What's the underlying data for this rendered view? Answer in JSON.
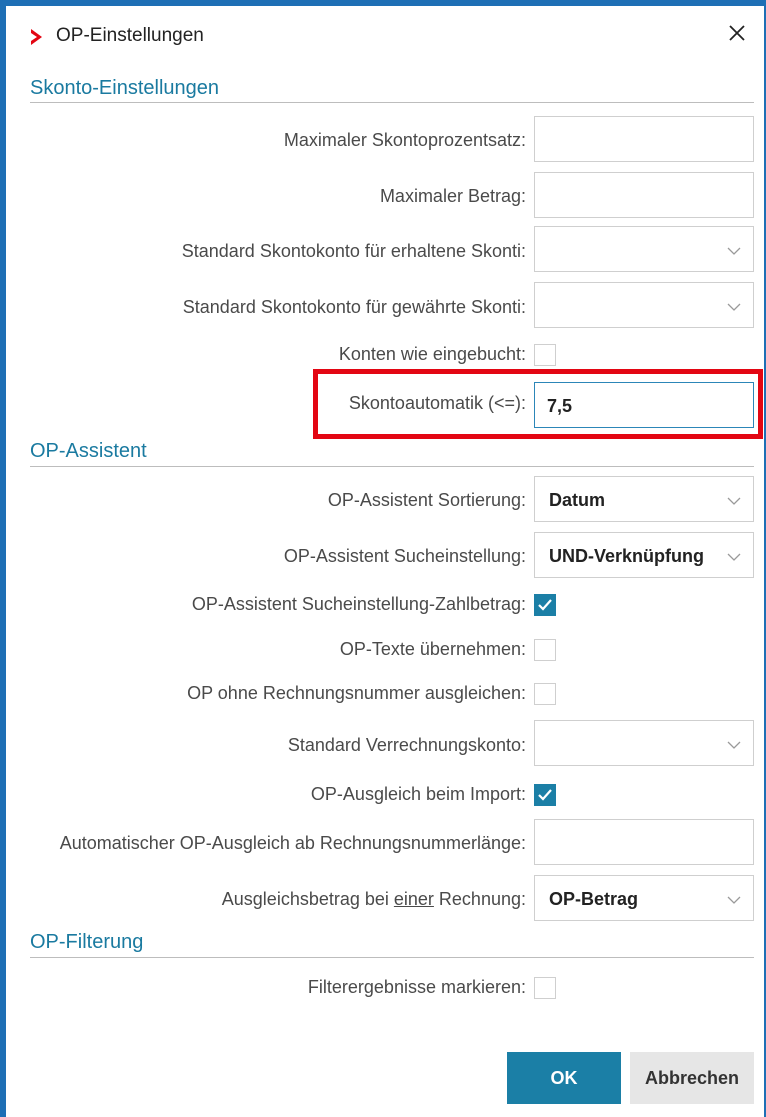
{
  "window": {
    "title": "OP-Einstellungen"
  },
  "sections": {
    "skonto": "Skonto-Einstellungen",
    "assistent": "OP-Assistent",
    "filterung": "OP-Filterung"
  },
  "skonto": {
    "max_percent_label": "Maximaler Skontoprozentsatz:",
    "max_percent_value": "",
    "max_amount_label": "Maximaler Betrag:",
    "max_amount_value": "",
    "received_label": "Standard Skontokonto für erhaltene Skonti:",
    "received_value": "",
    "granted_label": "Standard Skontokonto für gewährte Skonti:",
    "granted_value": "",
    "accounts_as_booked_label": "Konten wie eingebucht:",
    "accounts_as_booked_checked": false,
    "auto_label": "Skontoautomatik (<=):",
    "auto_value": "7,5"
  },
  "assistent": {
    "sort_label": "OP-Assistent Sortierung:",
    "sort_value": "Datum",
    "search_label": "OP-Assistent Sucheinstellung:",
    "search_value": "UND-Verknüpfung",
    "search_amount_label": "OP-Assistent Sucheinstellung-Zahlbetrag:",
    "search_amount_checked": true,
    "texts_label": "OP-Texte übernehmen:",
    "texts_checked": false,
    "no_invoice_label": "OP ohne Rechnungsnummer ausgleichen:",
    "no_invoice_checked": false,
    "clearing_account_label": "Standard Verrechnungskonto:",
    "clearing_account_value": "",
    "import_label": "OP-Ausgleich beim Import:",
    "import_checked": true,
    "auto_length_label": "Automatischer OP-Ausgleich ab Rechnungsnummerlänge:",
    "auto_length_value": "",
    "amount_label_pre": "Ausgleichsbetrag bei ",
    "amount_label_u": "einer",
    "amount_label_post": " Rechnung:",
    "amount_value": "OP-Betrag"
  },
  "filterung": {
    "mark_label": "Filterergebnisse markieren:",
    "mark_checked": false
  },
  "buttons": {
    "ok": "OK",
    "cancel": "Abbrechen"
  },
  "colors": {
    "accent": "#1b7fa6",
    "frame": "#1e6fb5",
    "highlight": "#e30613",
    "section": "#1a7aa0"
  }
}
